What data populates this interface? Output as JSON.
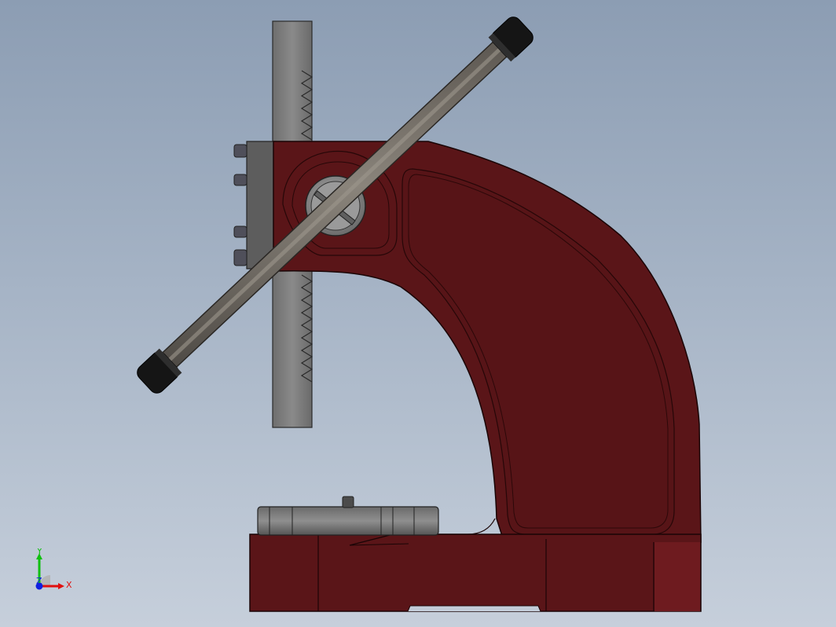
{
  "triad": {
    "x_label": "X",
    "y_label": "Y",
    "z_label": "Z"
  },
  "colors": {
    "background_top": "#8c9db3",
    "background_bottom": "#c6cfdb",
    "frame_red": "#5a1518",
    "frame_highlight": "#7a1f22",
    "rack_gray": "#7d7d7d",
    "handle_gray": "#6f6a64",
    "knob_black": "#151515",
    "axis_x": "#e01010",
    "axis_y": "#10c010",
    "axis_z": "#1020e0"
  }
}
